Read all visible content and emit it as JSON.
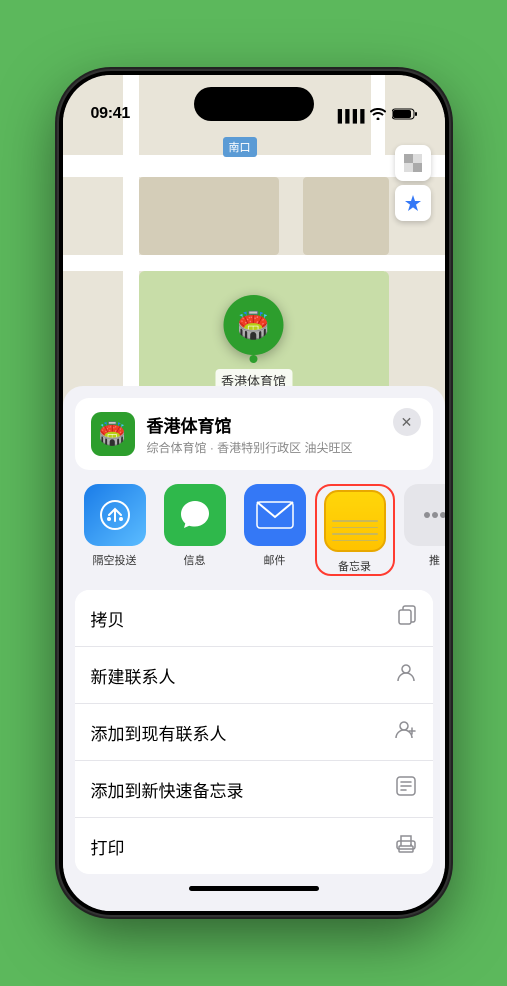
{
  "status_bar": {
    "time": "09:41",
    "location_icon": "▶",
    "signal": "●●●●",
    "wifi": "wifi",
    "battery": "battery"
  },
  "map": {
    "north_label": "南口",
    "venue_label": "香港体育馆"
  },
  "venue_card": {
    "name": "香港体育馆",
    "subtitle": "综合体育馆 · 香港特别行政区 油尖旺区",
    "close_icon": "✕"
  },
  "share_items": [
    {
      "id": "airdrop",
      "label": "隔空投送",
      "type": "airdrop"
    },
    {
      "id": "messages",
      "label": "信息",
      "type": "messages"
    },
    {
      "id": "mail",
      "label": "邮件",
      "type": "mail"
    },
    {
      "id": "notes",
      "label": "备忘录",
      "type": "notes",
      "highlighted": true
    },
    {
      "id": "more",
      "label": "推",
      "type": "more"
    }
  ],
  "action_items": [
    {
      "id": "copy",
      "label": "拷贝",
      "icon": "copy"
    },
    {
      "id": "new-contact",
      "label": "新建联系人",
      "icon": "person"
    },
    {
      "id": "add-existing",
      "label": "添加到现有联系人",
      "icon": "person-add"
    },
    {
      "id": "add-note",
      "label": "添加到新快速备忘录",
      "icon": "note"
    },
    {
      "id": "print",
      "label": "打印",
      "icon": "print"
    }
  ]
}
